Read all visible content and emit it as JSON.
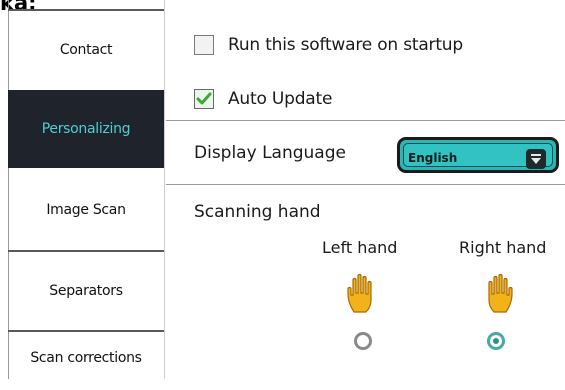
{
  "header_fragment": "ka:",
  "sidebar": {
    "items": [
      {
        "label": "Contact",
        "active": false
      },
      {
        "label": "Personalizing",
        "active": true
      },
      {
        "label": "Image Scan",
        "active": false
      },
      {
        "label": "Separators",
        "active": false
      },
      {
        "label": "Scan corrections",
        "active": false
      }
    ]
  },
  "settings": {
    "startup": {
      "label": "Run this software on startup",
      "checked": false
    },
    "auto_update": {
      "label": "Auto Update",
      "checked": true
    },
    "language": {
      "label": "Display Language",
      "selected": "English"
    },
    "scanning_hand": {
      "title": "Scanning hand",
      "left": {
        "label": "Left hand",
        "selected": false
      },
      "right": {
        "label": "Right hand",
        "selected": true
      }
    }
  },
  "colors": {
    "active_sidebar_bg": "#1f232b",
    "active_sidebar_text": "#4fd0d0",
    "accent_teal": "#2bb5b5",
    "checkmark_green": "#3aa83a",
    "hand_yellow": "#f2b21b"
  }
}
